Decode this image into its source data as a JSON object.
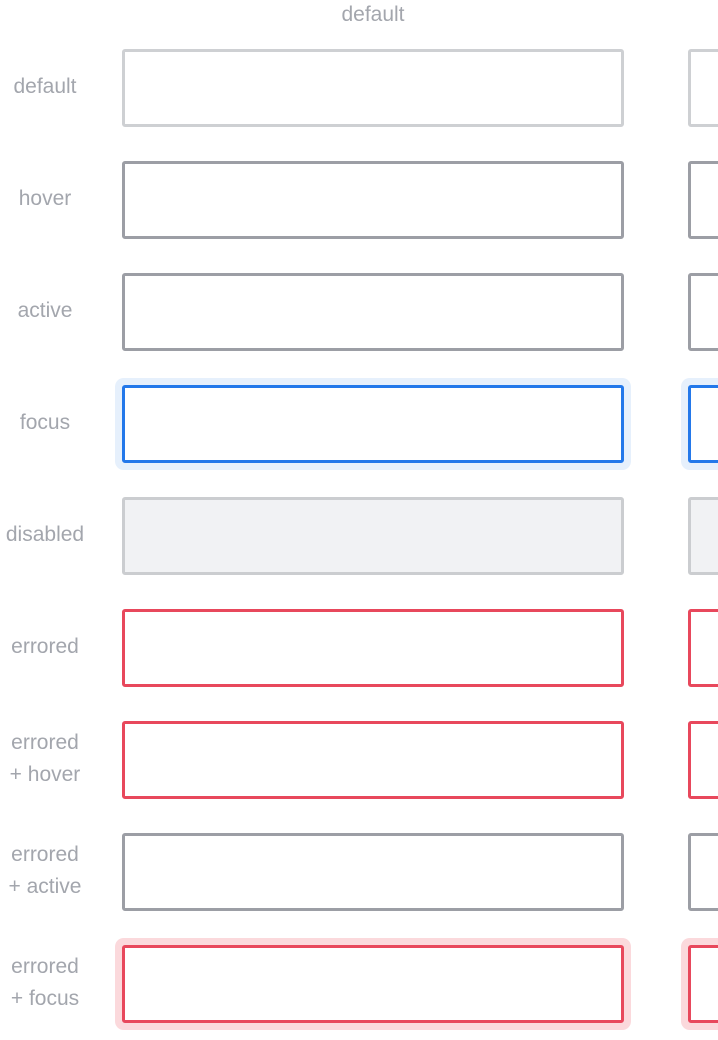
{
  "column_header": "default",
  "rows": [
    {
      "label_lines": [
        "default"
      ],
      "state": "default",
      "value": ""
    },
    {
      "label_lines": [
        "hover"
      ],
      "state": "hover",
      "value": ""
    },
    {
      "label_lines": [
        "active"
      ],
      "state": "active",
      "value": ""
    },
    {
      "label_lines": [
        "focus"
      ],
      "state": "focus",
      "value": ""
    },
    {
      "label_lines": [
        "disabled"
      ],
      "state": "disabled",
      "value": ""
    },
    {
      "label_lines": [
        "errored"
      ],
      "state": "errored",
      "value": ""
    },
    {
      "label_lines": [
        "errored",
        "+ hover"
      ],
      "state": "errored-hover",
      "value": ""
    },
    {
      "label_lines": [
        "errored",
        "+ active"
      ],
      "state": "errored-active",
      "value": ""
    },
    {
      "label_lines": [
        "errored",
        "+ focus"
      ],
      "state": "errored-focus",
      "value": ""
    }
  ],
  "colors": {
    "label_text": "#a3a6ad",
    "border_default": "#ced0d3",
    "border_hover": "#9c9ea5",
    "border_focus": "#2378ea",
    "focus_ring": "#e6f0fc",
    "disabled_fill": "#f1f2f4",
    "border_error": "#e8485c",
    "error_focus_ring": "#fbd9dc"
  }
}
